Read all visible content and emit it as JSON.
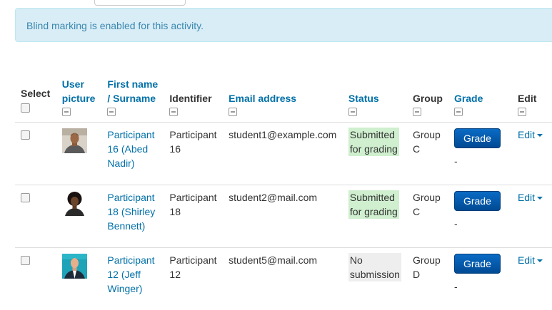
{
  "alert": {
    "text": "Blind marking is enabled for this activity."
  },
  "table": {
    "headers": {
      "select": "Select",
      "user_picture_line1": "User",
      "user_picture_line2": "picture",
      "name_line1": "First name",
      "name_line2": "/ Surname",
      "identifier": "Identifier",
      "email": "Email address",
      "status": "Status",
      "group": "Group",
      "grade": "Grade",
      "edit": "Edit"
    },
    "rows": [
      {
        "name_l1": "Participant",
        "name_l2": "16 (Abed",
        "name_l3": "Nadir)",
        "identifier_l1": "Participant",
        "identifier_l2": "16",
        "email": "student1@example.com",
        "status_l1": "Submitted",
        "status_l2": "for grading",
        "group_l1": "Group",
        "group_l2": "C",
        "grade_button": "Grade",
        "grade_value": "-",
        "edit_label": "Edit"
      },
      {
        "name_l1": "Participant",
        "name_l2": "18 (Shirley",
        "name_l3": "Bennett)",
        "identifier_l1": "Participant",
        "identifier_l2": "18",
        "email": "student2@mail.com",
        "status_l1": "Submitted",
        "status_l2": "for grading",
        "group_l1": "Group",
        "group_l2": "C",
        "grade_button": "Grade",
        "grade_value": "-",
        "edit_label": "Edit"
      },
      {
        "name_l1": "Participant",
        "name_l2": "12 (Jeff",
        "name_l3": "Winger)",
        "identifier_l1": "Participant",
        "identifier_l2": "12",
        "email": "student5@mail.com",
        "status_l1": "No",
        "status_l2": "submission",
        "group_l1": "Group",
        "group_l2": "D",
        "grade_button": "Grade",
        "grade_value": "-",
        "edit_label": "Edit"
      }
    ]
  },
  "colors": {
    "link": "#0070a8",
    "alert_bg": "#d9edf7",
    "alert_text": "#3a87ad",
    "submitted_bg": "#cfefcf",
    "nosub_bg": "#eeeeee",
    "grade_button": "#0a5fb4"
  }
}
